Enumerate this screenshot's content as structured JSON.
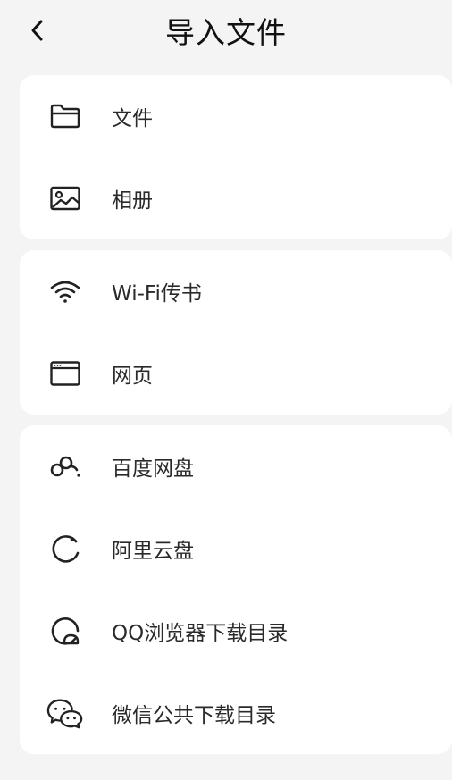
{
  "header": {
    "title": "导入文件",
    "back_icon": "chevron-left-icon"
  },
  "groups": [
    {
      "items": [
        {
          "label": "文件",
          "icon": "folder-icon"
        },
        {
          "label": "相册",
          "icon": "image-icon"
        }
      ]
    },
    {
      "items": [
        {
          "label": "Wi-Fi传书",
          "icon": "wifi-icon"
        },
        {
          "label": "网页",
          "icon": "browser-window-icon"
        }
      ]
    },
    {
      "items": [
        {
          "label": "百度网盘",
          "icon": "baidu-netdisk-icon"
        },
        {
          "label": "阿里云盘",
          "icon": "aliyun-drive-icon"
        },
        {
          "label": "QQ浏览器下载目录",
          "icon": "qq-browser-icon"
        },
        {
          "label": "微信公共下载目录",
          "icon": "wechat-icon"
        }
      ]
    }
  ]
}
